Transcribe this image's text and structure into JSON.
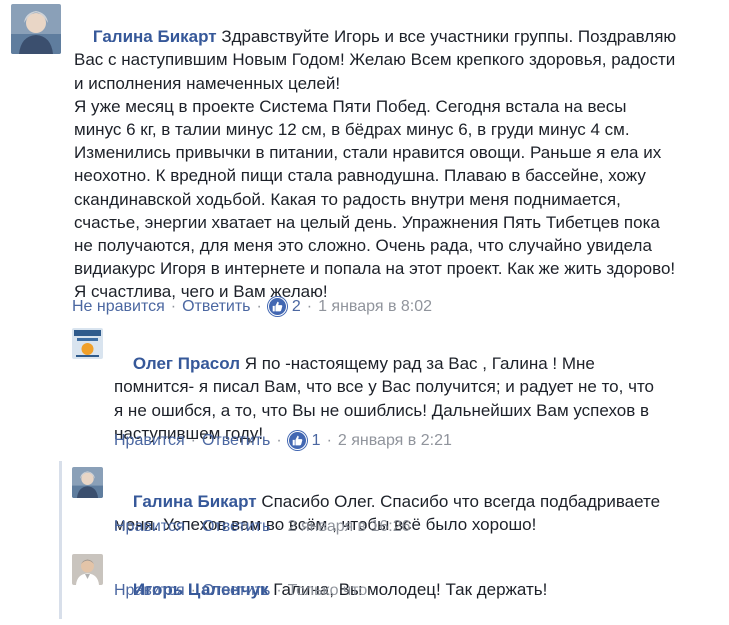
{
  "colors": {
    "author_link": "#365899",
    "action_link": "#4b67a1",
    "meta_text": "#90949c",
    "like_badge": "#4267b2",
    "reply_bar": "#d8dfea"
  },
  "comments": [
    {
      "author": "Галина Бикарт",
      "text_lines": [
        " Здравствуйте Игорь и все участники группы. Поздравляю",
        "Вас с наступившим Новым Годом! Желаю Всем крепкого здоровья, радости",
        "и исполнения намеченных целей!",
        "Я уже месяц в проекте Система Пяти Побед. Сегодня встала на весы",
        "минус 6 кг, в талии минус 12 см, в бёдрах минус 6, в груди минус 4 см.",
        "Изменились привычки в питании, стали нравится овощи. Раньше я ела их",
        "неохотно. К вредной пищи стала равнодушна. Плаваю в бассейне, хожу",
        "скандинавской ходьбой. Какая то радость внутри меня поднимается,",
        "счастье, энергии хватает на целый день. Упражнения Пять Тибетцев пока",
        "не получаются, для меня это сложно. Очень рада, что случайно увидела",
        "видиакурс Игоря в интернете и попала на этот проект. Как же жить здорово!",
        "Я счастлива, чего и Вам желаю!"
      ],
      "like_label": "Не нравится",
      "reply_label": "Ответить",
      "like_count": "2",
      "timestamp": "1 января в 8:02",
      "avatar_icon": "user-photo-woman"
    },
    {
      "author": "Олег Прасол",
      "text_lines": [
        " Я по -настоящему рад за Вас , Галина ! Мне",
        "помнится- я писал Вам, что все у Вас получится; и радует не то, что",
        "я не ошибся, а то, что Вы не ошиблись! Дальнейших Вам успехов в",
        "наступившем году!"
      ],
      "like_label": "Нравится",
      "reply_label": "Ответить",
      "like_count": "1",
      "timestamp": "2 января в 2:21",
      "avatar_icon": "book-cover-avatar"
    },
    {
      "author": "Галина Бикарт",
      "text_lines": [
        " Спасибо Олег. Спасибо что всегда подбадриваете",
        "меня. Успехов вам во всём , чтобы всё было хорошо!"
      ],
      "like_label": "Нравится",
      "reply_label": "Ответить",
      "timestamp": "2 января в 16:26",
      "avatar_icon": "user-photo-woman"
    },
    {
      "author": "Игорь Цаленчук",
      "text_lines": [
        " Галина, Вы молодец! Так держать!"
      ],
      "like_label": "Нравится",
      "reply_label": "Ответить",
      "timestamp": "Только что",
      "avatar_icon": "user-photo-man"
    }
  ]
}
